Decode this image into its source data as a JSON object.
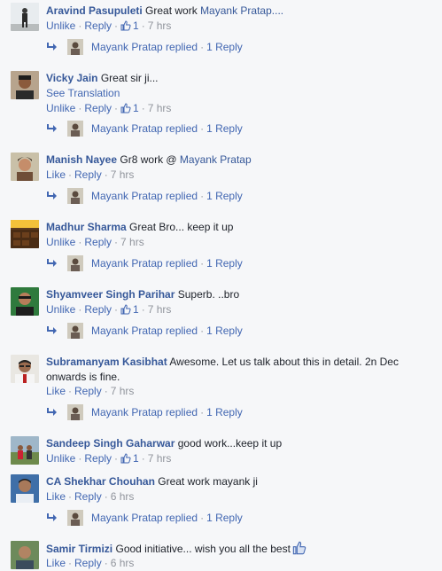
{
  "comments": [
    {
      "author": "Aravind Pasupuleti",
      "text": "Great work ",
      "mention": "Mayank Pratap....",
      "like_label": "Unlike",
      "reply_label": "Reply",
      "like_count": "1",
      "time": "7 hrs",
      "replies": {
        "name": "Mayank Pratap replied",
        "count": "1 Reply"
      }
    },
    {
      "author": "Vicky Jain",
      "text": "Great sir ji...",
      "see_translation": "See Translation",
      "like_label": "Unlike",
      "reply_label": "Reply",
      "like_count": "1",
      "time": "7 hrs",
      "replies": {
        "name": "Mayank Pratap replied",
        "count": "1 Reply"
      }
    },
    {
      "author": "Manish Nayee",
      "text": "Gr8 work @ ",
      "mention": "Mayank Pratap",
      "like_label": "Like",
      "reply_label": "Reply",
      "time": "7 hrs",
      "replies": {
        "name": "Mayank Pratap replied",
        "count": "1 Reply"
      }
    },
    {
      "author": "Madhur Sharma",
      "text": "Great Bro... keep it up",
      "like_label": "Unlike",
      "reply_label": "Reply",
      "time": "7 hrs",
      "replies": {
        "name": "Mayank Pratap replied",
        "count": "1 Reply"
      }
    },
    {
      "author": "Shyamveer Singh Parihar",
      "text": "Superb. ..bro",
      "like_label": "Unlike",
      "reply_label": "Reply",
      "like_count": "1",
      "time": "7 hrs",
      "replies": {
        "name": "Mayank Pratap replied",
        "count": "1 Reply"
      }
    },
    {
      "author": "Subramanyam Kasibhat",
      "text": "Awesome. Let us talk about this in detail. 2n Dec onwards is fine.",
      "like_label": "Like",
      "reply_label": "Reply",
      "time": "7 hrs",
      "replies": {
        "name": "Mayank Pratap replied",
        "count": "1 Reply"
      }
    },
    {
      "author": "Sandeep Singh Gaharwar",
      "text": "good work...keep it up",
      "like_label": "Unlike",
      "reply_label": "Reply",
      "like_count": "1",
      "time": "7 hrs"
    },
    {
      "author": "CA Shekhar Chouhan",
      "text": "Great work mayank ji",
      "like_label": "Like",
      "reply_label": "Reply",
      "time": "6 hrs",
      "replies": {
        "name": "Mayank Pratap replied",
        "count": "1 Reply"
      }
    },
    {
      "author": "Samir Tirmizi",
      "text": "Good initiative... wish you all the best",
      "like_label": "Like",
      "reply_label": "Reply",
      "time": "6 hrs"
    }
  ],
  "colors": {
    "link": "#4267b2",
    "author": "#365899",
    "meta": "#90949c",
    "background": "#f6f7f9"
  },
  "icons": [
    "thumbs-up-icon",
    "reply-arrow-icon"
  ]
}
